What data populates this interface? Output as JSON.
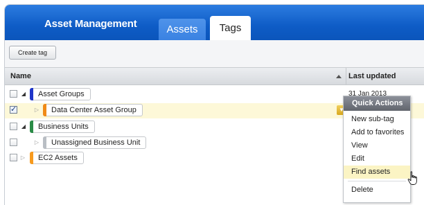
{
  "app": {
    "title": "Asset Management"
  },
  "tabs": [
    {
      "label": "Assets",
      "active": false
    },
    {
      "label": "Tags",
      "active": true
    }
  ],
  "toolbar": {
    "create_tag_label": "Create tag"
  },
  "table": {
    "columns": {
      "name": "Name",
      "last_updated": "Last updated"
    },
    "rows": [
      {
        "label": "Asset Groups",
        "checked": false,
        "expanded": true,
        "color": "#1f35c9",
        "date": "31 Jan 2013"
      },
      {
        "label": "Data Center Asset Group",
        "checked": true,
        "expanded": false,
        "color": "#f08a16",
        "date": ""
      },
      {
        "label": "Business Units",
        "checked": false,
        "expanded": true,
        "color": "#2a8b46",
        "date": ""
      },
      {
        "label": "Unassigned Business Unit",
        "checked": false,
        "expanded": false,
        "color": "#b9bec4",
        "date": ""
      },
      {
        "label": "EC2 Assets",
        "checked": false,
        "expanded": false,
        "color": "#f79a1e",
        "date": ""
      }
    ]
  },
  "quick_actions": {
    "title": "Quick Actions",
    "items": [
      "New sub-tag",
      "Add to favorites",
      "View",
      "Edit",
      "Find assets",
      "Delete"
    ],
    "hovered": "Find assets"
  },
  "icons": {
    "sort": "sort-ascending-icon",
    "expand": "tree-expander-icon",
    "dropdown": "chevron-down-icon",
    "cursor": "hand-pointer-icon"
  },
  "colors": {
    "brand_blue": "#0e5cc6",
    "selected_row": "#fdf8d8",
    "menu_hover": "#fbf4c4"
  }
}
